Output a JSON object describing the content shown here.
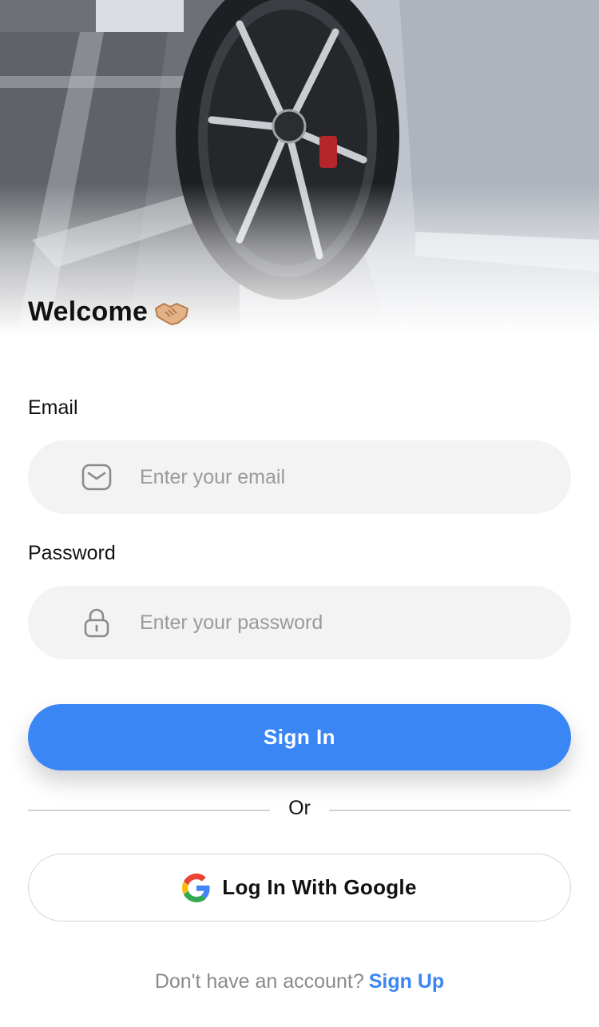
{
  "hero": {
    "image_description_icon": "car-wheel-photo"
  },
  "welcome": {
    "title": "Welcome",
    "emoji_icon": "handshake-icon"
  },
  "form": {
    "email": {
      "label": "Email",
      "placeholder": "Enter your email",
      "value": "",
      "icon": "mail-icon"
    },
    "password": {
      "label": "Password",
      "placeholder": "Enter your password",
      "value": "",
      "icon": "lock-icon"
    }
  },
  "buttons": {
    "sign_in": "Sign In",
    "divider": "Or",
    "google": "Log In With Google",
    "google_icon": "google-icon"
  },
  "footer": {
    "prompt": "Don't have an account?",
    "link": "Sign Up"
  },
  "colors": {
    "accent": "#3b86f5",
    "input_bg": "#f3f3f4",
    "text": "#111111",
    "muted": "#8a8a8e"
  }
}
